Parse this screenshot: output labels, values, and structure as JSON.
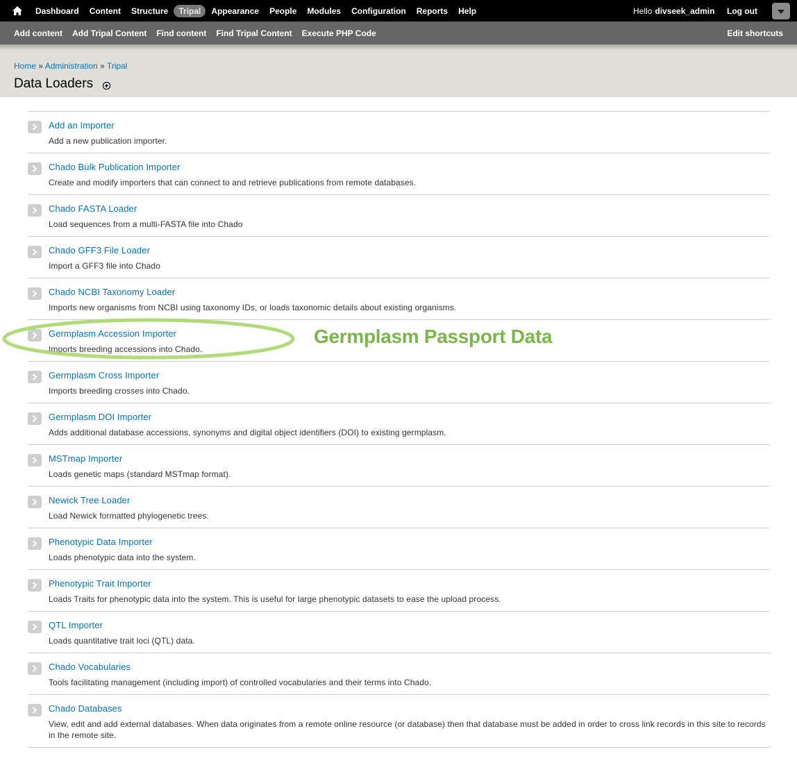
{
  "toolbar": {
    "menu": [
      "Dashboard",
      "Content",
      "Structure",
      "Tripal",
      "Appearance",
      "People",
      "Modules",
      "Configuration",
      "Reports",
      "Help"
    ],
    "active_index": 3,
    "hello": "Hello",
    "username": "divseek_admin",
    "logout": "Log out"
  },
  "shortcuts": {
    "links": [
      "Add content",
      "Add Tripal Content",
      "Find content",
      "Find Tripal Content",
      "Execute PHP Code"
    ],
    "edit": "Edit shortcuts"
  },
  "breadcrumb": [
    "Home",
    "Administration",
    "Tripal"
  ],
  "breadcrumb_separator": "»",
  "page_title": "Data Loaders",
  "items": [
    {
      "title": "Add an Importer",
      "description": "Add a new publication importer."
    },
    {
      "title": "Chado Bulk Publication Importer",
      "description": "Create and modify importers that can connect to and retrieve publications from remote databases."
    },
    {
      "title": "Chado FASTA Loader",
      "description": "Load sequences from a multi-FASTA file into Chado"
    },
    {
      "title": "Chado GFF3 File Loader",
      "description": "Import a GFF3 file into Chado"
    },
    {
      "title": "Chado NCBI Taxonomy Loader",
      "description": "Imports new organisms from NCBI using taxonomy IDs, or loads taxonomic details about existing organisms."
    },
    {
      "title": "Germplasm Accession Importer",
      "description": "Imports breeding accessions into Chado."
    },
    {
      "title": "Germplasm Cross Importer",
      "description": "Imports breeding crosses into Chado."
    },
    {
      "title": "Germplasm DOI Importer",
      "description": "Adds additional database accessions, synonyms and digital object identifiers (DOI) to existing germplasm."
    },
    {
      "title": "MSTmap Importer",
      "description": "Loads genetic maps (standard MSTmap format)."
    },
    {
      "title": "Newick Tree Loader",
      "description": "Load Newick formatted phylogenetic trees."
    },
    {
      "title": "Phenotypic Data Importer",
      "description": "Loads phenotypic data into the system."
    },
    {
      "title": "Phenotypic Trait Importer",
      "description": "Loads Traits for phenotypic data into the system. This is useful for large phenotypic datasets to ease the upload process."
    },
    {
      "title": "QTL Importer",
      "description": "Loads quantitative trait loci (QTL) data."
    },
    {
      "title": "Chado Vocabularies",
      "description": "Tools facilitating management (including import) of controlled vocabularies and their terms into Chado."
    },
    {
      "title": "Chado Databases",
      "description": "View, edit and add external databases. When data originates from a remote online resource (or database) then that database must be added in order to cross link records in this site to records in the remote site."
    }
  ],
  "annotation": {
    "label": "Germplasm Passport Data",
    "color": "#7ab648"
  },
  "colors": {
    "link": "#0074bd",
    "toolbar": "#000000",
    "shortcuts": "#666666"
  },
  "icons": {
    "home": "home-icon",
    "add_shortcut": "plus-circle-icon",
    "list_arrow": "chevron-right-icon",
    "drawer": "chevron-down-icon"
  }
}
